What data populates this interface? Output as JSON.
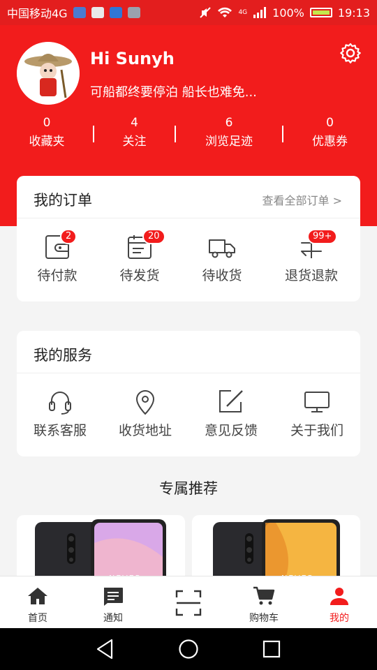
{
  "status_bar": {
    "carrier": "中国移动4G",
    "network_tag": "4G",
    "battery": "100%",
    "time": "19:13"
  },
  "profile": {
    "greeting": "Hi Sunyh",
    "motto": "可船都终要停泊 船长也难免...",
    "stats": [
      {
        "value": "0",
        "label": "收藏夹"
      },
      {
        "value": "4",
        "label": "关注"
      },
      {
        "value": "6",
        "label": "浏览足迹"
      },
      {
        "value": "0",
        "label": "优惠券"
      }
    ]
  },
  "orders": {
    "title": "我的订单",
    "view_all": "查看全部订单 >",
    "items": [
      {
        "label": "待付款",
        "badge": "2",
        "icon": "wallet-icon"
      },
      {
        "label": "待发货",
        "badge": "20",
        "icon": "package-list-icon"
      },
      {
        "label": "待收货",
        "badge": "",
        "icon": "truck-icon"
      },
      {
        "label": "退货退款",
        "badge": "99+",
        "icon": "refund-icon"
      }
    ]
  },
  "services": {
    "title": "我的服务",
    "items": [
      {
        "label": "联系客服",
        "icon": "headset-icon"
      },
      {
        "label": "收货地址",
        "icon": "location-pin-icon"
      },
      {
        "label": "意见反馈",
        "icon": "edit-icon"
      },
      {
        "label": "关于我们",
        "icon": "monitor-icon"
      }
    ]
  },
  "recommend": {
    "title": "专属推荐",
    "products": [
      {
        "tag": "NEVER",
        "color": "#d9a8e8"
      },
      {
        "tag": "NEVER",
        "color": "#f5b541"
      }
    ]
  },
  "tabbar": {
    "items": [
      {
        "label": "首页",
        "icon": "home-icon",
        "active": false
      },
      {
        "label": "通知",
        "icon": "message-icon",
        "active": false
      },
      {
        "label": "",
        "icon": "scan-icon",
        "active": false
      },
      {
        "label": "购物车",
        "icon": "cart-icon",
        "active": false
      },
      {
        "label": "我的",
        "icon": "person-icon",
        "active": true
      }
    ]
  },
  "colors": {
    "brand_red": "#f21c1c",
    "status_bar_red": "#e31e1e",
    "badge_red": "#f21c1c"
  }
}
